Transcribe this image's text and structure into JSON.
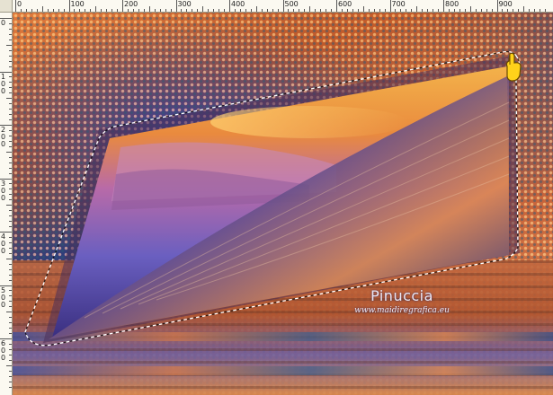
{
  "ruler": {
    "horizontal_labels": [
      "0",
      "100",
      "200",
      "300",
      "400",
      "500",
      "600",
      "700",
      "800",
      "900"
    ],
    "vertical_labels": [
      "0",
      "100",
      "200",
      "300",
      "400",
      "500",
      "600"
    ]
  },
  "canvas": {
    "tool_cursor_icon": "pointing-hand-icon",
    "selection": "marching-ants-freehand",
    "colors": {
      "orange": "#e07a3c",
      "navy": "#2a2f78",
      "purple": "#6a4fb0",
      "gold": "#f5d067"
    }
  },
  "watermark": {
    "name": "Pinuccia",
    "url": "www.maidiregrafica.eu"
  }
}
